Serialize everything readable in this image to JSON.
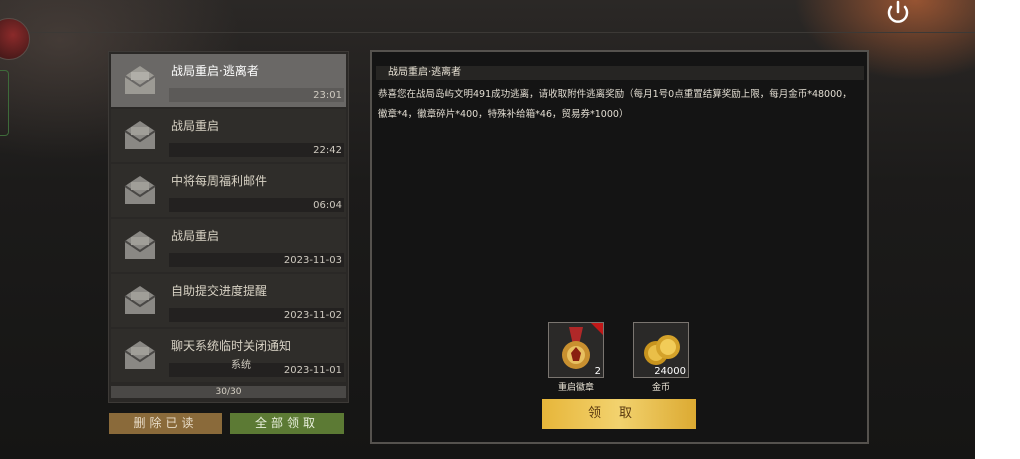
{
  "colors": {
    "accent_gold": "#e7b63a",
    "delete_button": "#8a6a3a",
    "claim_all_button": "#5c7a34"
  },
  "mail_list": {
    "items": [
      {
        "title": "战局重启·逃离者",
        "sender": "",
        "time": "23:01",
        "selected": true,
        "icon": "envelope-icon"
      },
      {
        "title": "战局重启",
        "sender": "",
        "time": "22:42",
        "selected": false,
        "icon": "envelope-icon"
      },
      {
        "title": "中将每周福利邮件",
        "sender": "",
        "time": "06:04",
        "selected": false,
        "icon": "envelope-icon"
      },
      {
        "title": "战局重启",
        "sender": "",
        "time": "2023-11-03",
        "selected": false,
        "icon": "envelope-icon"
      },
      {
        "title": "自助提交进度提醒",
        "sender": "",
        "time": "2023-11-02",
        "selected": false,
        "icon": "envelope-icon"
      },
      {
        "title": "聊天系统临时关闭通知",
        "sender": "系统",
        "time": "2023-11-01",
        "selected": false,
        "icon": "envelope-icon"
      }
    ],
    "counter": "30/30"
  },
  "buttons": {
    "delete_read": "删除已读",
    "claim_all": "全部领取",
    "claim": "领取"
  },
  "detail": {
    "title": "战局重启·逃离者",
    "body": "恭喜您在战局岛屿文明491成功逃离，请收取附件逃离奖励（每月1号0点重置结算奖励上限，每月金币*48000，徽章*4，徽章碎片*400，特殊补给箱*46，贸易券*1000）",
    "rewards": [
      {
        "name": "重启徽章",
        "count": "2",
        "icon": "medal-icon",
        "new": true
      },
      {
        "name": "金币",
        "count": "24000",
        "icon": "gold-coins-icon",
        "new": false
      }
    ]
  }
}
